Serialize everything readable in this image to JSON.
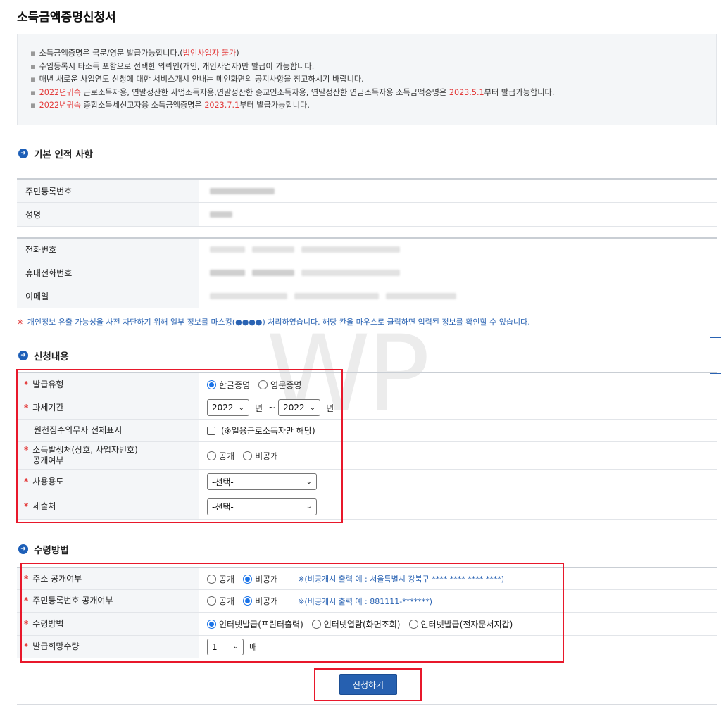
{
  "page": {
    "title": "소득금액증명신청서"
  },
  "notice": {
    "lines": [
      {
        "pre": "소득금액증명은 국문/영문 발급가능합니다.(",
        "red": "법인사업자 불가",
        "post": ")"
      },
      {
        "pre": "수임등록시 타소득 포함으로 선택한 의뢰인(개인, 개인사업자)만 발급이 가능합니다.",
        "red": "",
        "post": ""
      },
      {
        "pre": "매년 새로운 사업연도 신청에 대한 서비스개시 안내는 메인화면의 공지사항을 참고하시기 바랍니다.",
        "red": "",
        "post": ""
      },
      {
        "red": "2022년귀속",
        "mid": " 근로소득자용, 연말정산한 사업소득자용,연말정산한 종교인소득자용, 연말정산한 연금소득자용 소득금액증명은 ",
        "red2": "2023.5.1",
        "post": "부터 발급가능합니다."
      },
      {
        "red": "2022년귀속",
        "mid": " 종합소득세신고자용 소득금액증명은 ",
        "red2": "2023.7.1",
        "post": "부터 발급가능합니다."
      }
    ]
  },
  "basic_info": {
    "section_title": "기본 인적 사항",
    "rows": [
      {
        "label": "주민등록번호"
      },
      {
        "label": "성명"
      },
      {
        "label": "전화번호"
      },
      {
        "label": "휴대전화번호"
      },
      {
        "label": "이메일"
      }
    ],
    "privacy_note_mark": "※",
    "privacy_note": " 개인정보 유출 가능성을 사전 차단하기 위해 일부 정보를 마스킹(●●●●) 처리하였습니다. 해당 칸을 마우스로 클릭하면 입력된 정보를 확인할 수 있습니다."
  },
  "application": {
    "section_title": "신청내용",
    "required_mark": "*",
    "issue_type": {
      "label": "발급유형",
      "options": [
        "한글증명",
        "영문증명"
      ],
      "selected": 0
    },
    "tax_period": {
      "label": "과세기간",
      "from_year": "2022",
      "to_year": "2022",
      "year_unit": "년",
      "tilde": "~"
    },
    "withholding": {
      "label": "원천징수의무자 전체표시",
      "checkbox_label": "(※일용근로소득자만 해당)"
    },
    "income_source": {
      "label_line1": "소득발생처(상호, 사업자번호)",
      "label_line2": "공개여부",
      "options": [
        "공개",
        "비공개"
      ]
    },
    "usage": {
      "label": "사용용도",
      "value": "-선택-"
    },
    "submit_to": {
      "label": "제출처",
      "value": "-선택-"
    }
  },
  "receipt": {
    "section_title": "수령방법",
    "address_disclosure": {
      "label": "주소 공개여부",
      "options": [
        "공개",
        "비공개"
      ],
      "selected": 1,
      "note": "※(비공개시 출력 예 : 서울특별시 강북구 **** **** **** ****)"
    },
    "rrn_disclosure": {
      "label": "주민등록번호 공개여부",
      "options": [
        "공개",
        "비공개"
      ],
      "selected": 1,
      "note": "※(비공개시 출력 예 : 881111-*******)"
    },
    "method": {
      "label": "수령방법",
      "options": [
        "인터넷발급(프린터출력)",
        "인터넷열람(화면조회)",
        "인터넷발급(전자문서지갑)"
      ],
      "selected": 0
    },
    "copies": {
      "label": "발급희망수량",
      "value": "1",
      "unit": "매"
    }
  },
  "actions": {
    "apply_label": "신청하기"
  },
  "watermark": {
    "text": "WP"
  },
  "colors": {
    "accent_blue": "#2660b0",
    "required_red": "#e33b3b",
    "highlight_box": "#e8182b"
  }
}
